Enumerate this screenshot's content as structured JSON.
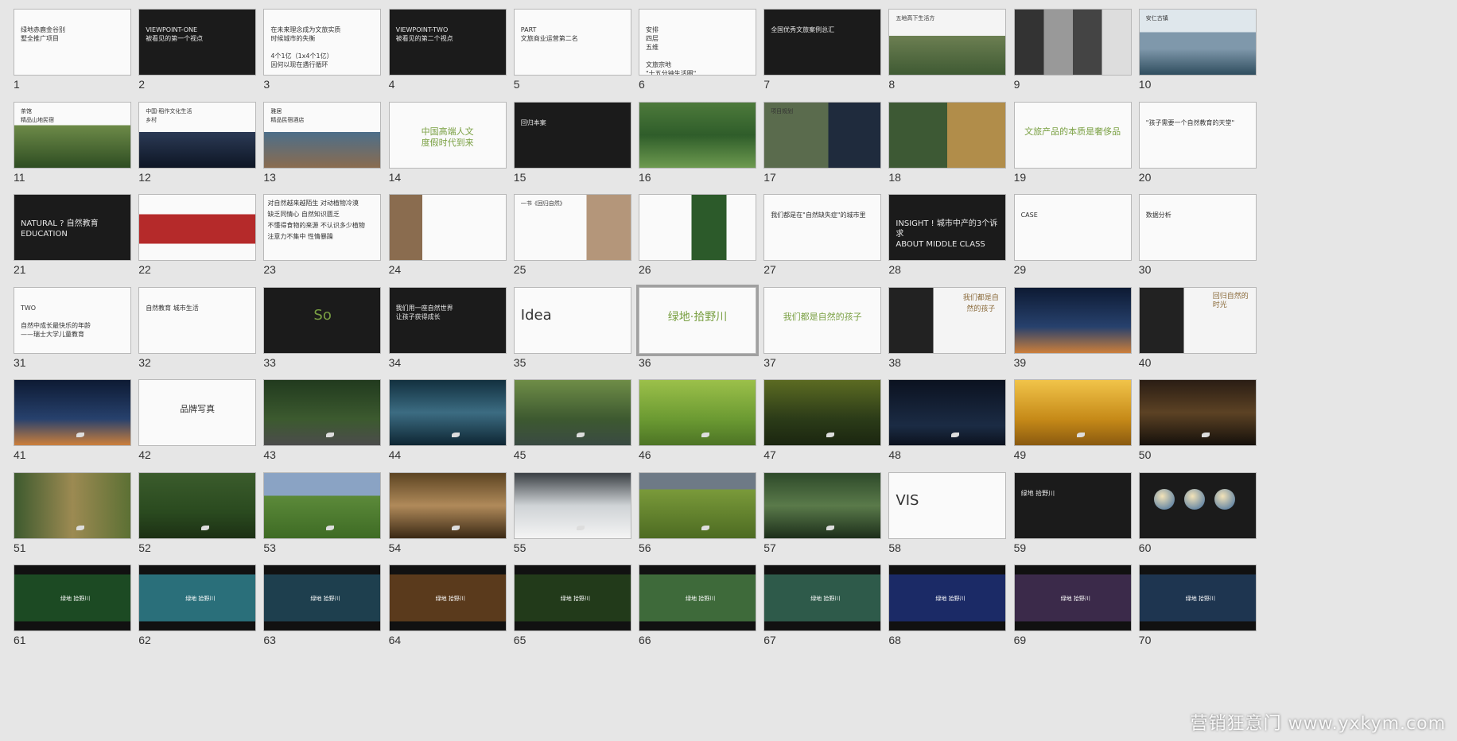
{
  "watermark": "营销狂意门 www.yxkym.com",
  "colors": {
    "background": "#e6e6e6",
    "dark_slide": "#1b1b1b",
    "light_slide": "#fafafa",
    "accent_green": "#7aa043"
  },
  "slides": [
    {
      "num": "1",
      "bg": "light",
      "text": "绿地赤鹿金谷别\n墅全推广项目"
    },
    {
      "num": "2",
      "bg": "dark",
      "text": "VIEWPOINT-ONE\n被看见的第一个视点"
    },
    {
      "num": "3",
      "bg": "light",
      "text": "在未来理念成为文旅实质\n时候城市的失衡\n\n4个1亿（1x4个1亿）\n因何以现在遇行循环"
    },
    {
      "num": "4",
      "bg": "dark",
      "text": "VIEWPOINT-TWO\n被看见的第二个视点"
    },
    {
      "num": "5",
      "bg": "light",
      "text": "PART\n文旅商业运营第二名"
    },
    {
      "num": "6",
      "bg": "light",
      "text": "安排\n四层\n五维\n\n文旅宗地\n\"十五分钟生活圈\""
    },
    {
      "num": "7",
      "bg": "dark",
      "text": "全国优秀文旅案例总汇"
    },
    {
      "num": "8",
      "bg": "photo",
      "photo": "mountain",
      "text": "五地高下生活方"
    },
    {
      "num": "9",
      "bg": "photo",
      "photo": "people",
      "text": ""
    },
    {
      "num": "10",
      "bg": "photo",
      "photo": "lake",
      "text": "安仁古镇"
    },
    {
      "num": "11",
      "bg": "photo",
      "photo": "tea",
      "text": "茶馆\n精品山地民宿"
    },
    {
      "num": "12",
      "bg": "photo",
      "photo": "village",
      "text": "中国·稻作文化生活\n乡村"
    },
    {
      "num": "13",
      "bg": "photo",
      "photo": "resort",
      "text": "雅居\n精品民宿酒店"
    },
    {
      "num": "14",
      "bg": "light",
      "text": "中国高端人文\n度假时代到来"
    },
    {
      "num": "15",
      "bg": "dark",
      "text": "回归本案"
    },
    {
      "num": "16",
      "bg": "photo",
      "photo": "aerial",
      "text": ""
    },
    {
      "num": "17",
      "bg": "photo",
      "photo": "plan",
      "text": "项目规划"
    },
    {
      "num": "18",
      "bg": "photo",
      "photo": "collage",
      "text": ""
    },
    {
      "num": "19",
      "bg": "light",
      "text": "文旅产品的本质是奢侈品"
    },
    {
      "num": "20",
      "bg": "light",
      "text": "\"孩子需要一个自然教育的天堂\""
    },
    {
      "num": "21",
      "bg": "dark",
      "text": "NATURAL ? 自然教育\nEDUCATION"
    },
    {
      "num": "22",
      "bg": "photo",
      "photo": "books",
      "text": ""
    },
    {
      "num": "23",
      "bg": "light",
      "text": "对自然越来越陌生 对动植物冷漠\n缺乏同情心 自然知识匮乏\n不懂得食物的来源 不认识多少植物\n注意力不集中 性情暴躁"
    },
    {
      "num": "24",
      "bg": "photo",
      "photo": "kids",
      "text": ""
    },
    {
      "num": "25",
      "bg": "photo",
      "photo": "portrait",
      "text": "一书《回归自然》"
    },
    {
      "num": "26",
      "bg": "photo",
      "photo": "bookcover",
      "text": ""
    },
    {
      "num": "27",
      "bg": "light",
      "text": "我们都是在\"自然缺失症\"的城市里"
    },
    {
      "num": "28",
      "bg": "dark",
      "text": "INSIGHT ! 城市中产的3个诉求\nABOUT MIDDLE CLASS"
    },
    {
      "num": "29",
      "bg": "light",
      "text": "CASE"
    },
    {
      "num": "30",
      "bg": "light",
      "text": "数据分析"
    },
    {
      "num": "31",
      "bg": "light",
      "text": "TWO\n\n自然中成长最快乐的年龄\n——瑞士大学儿童教育"
    },
    {
      "num": "32",
      "bg": "light",
      "text": "自然教育      城市生活"
    },
    {
      "num": "33",
      "bg": "dark",
      "text": "So"
    },
    {
      "num": "34",
      "bg": "dark",
      "text": "我们用一座自然世界\n让孩子获得成长"
    },
    {
      "num": "35",
      "bg": "light",
      "text": "Idea"
    },
    {
      "num": "36",
      "bg": "light",
      "selected": true,
      "text": "绿地·拾野川"
    },
    {
      "num": "37",
      "bg": "light",
      "text": "我们都是自然的孩子"
    },
    {
      "num": "38",
      "bg": "photo",
      "photo": "billboard-night",
      "text": "我们都是自然的孩子"
    },
    {
      "num": "39",
      "bg": "photo",
      "photo": "billboard-dusk",
      "text": ""
    },
    {
      "num": "40",
      "bg": "photo",
      "photo": "billboard-white",
      "text": "回归自然的时光"
    },
    {
      "num": "41",
      "bg": "photo",
      "photo": "billboard-dusk",
      "text": ""
    },
    {
      "num": "42",
      "bg": "light",
      "text": "品牌写真"
    },
    {
      "num": "43",
      "bg": "photo",
      "photo": "forest-path",
      "text": ""
    },
    {
      "num": "44",
      "bg": "photo",
      "photo": "water",
      "text": ""
    },
    {
      "num": "45",
      "bg": "photo",
      "photo": "stream",
      "text": ""
    },
    {
      "num": "46",
      "bg": "photo",
      "photo": "leaf-boy",
      "text": ""
    },
    {
      "num": "47",
      "bg": "photo",
      "photo": "sunlit-forest",
      "text": ""
    },
    {
      "num": "48",
      "bg": "photo",
      "photo": "starry",
      "text": ""
    },
    {
      "num": "49",
      "bg": "photo",
      "photo": "wheat",
      "text": ""
    },
    {
      "num": "50",
      "bg": "photo",
      "photo": "dark-forest",
      "text": ""
    },
    {
      "num": "51",
      "bg": "photo",
      "photo": "woman",
      "text": ""
    },
    {
      "num": "52",
      "bg": "photo",
      "photo": "hikers",
      "text": ""
    },
    {
      "num": "53",
      "bg": "photo",
      "photo": "meadow",
      "text": ""
    },
    {
      "num": "54",
      "bg": "photo",
      "photo": "child",
      "text": ""
    },
    {
      "num": "55",
      "bg": "photo",
      "photo": "clouds",
      "text": ""
    },
    {
      "num": "56",
      "bg": "photo",
      "photo": "terraces",
      "text": ""
    },
    {
      "num": "57",
      "bg": "photo",
      "photo": "couple",
      "text": ""
    },
    {
      "num": "58",
      "bg": "light",
      "text": "VIS"
    },
    {
      "num": "59",
      "bg": "dark",
      "text": "绿地 拾野川"
    },
    {
      "num": "60",
      "bg": "dark",
      "circles": true,
      "text": ""
    },
    {
      "num": "61",
      "bg": "dark",
      "photo": "green-banner",
      "text": ""
    },
    {
      "num": "62",
      "bg": "dark",
      "photo": "teal-banner",
      "text": ""
    },
    {
      "num": "63",
      "bg": "dark",
      "photo": "lake-banner",
      "text": ""
    },
    {
      "num": "64",
      "bg": "dark",
      "photo": "campfire-banner",
      "text": ""
    },
    {
      "num": "65",
      "bg": "dark",
      "photo": "jungle-banner",
      "text": ""
    },
    {
      "num": "66",
      "bg": "dark",
      "photo": "field-banner",
      "text": ""
    },
    {
      "num": "67",
      "bg": "dark",
      "photo": "pool-banner",
      "text": ""
    },
    {
      "num": "68",
      "bg": "dark",
      "photo": "resort-night-banner",
      "text": ""
    },
    {
      "num": "69",
      "bg": "dark",
      "photo": "resort-dusk-banner",
      "text": ""
    },
    {
      "num": "70",
      "bg": "dark",
      "photo": "cabin-banner",
      "text": ""
    }
  ],
  "brand_mark": "绿地 拾野川"
}
